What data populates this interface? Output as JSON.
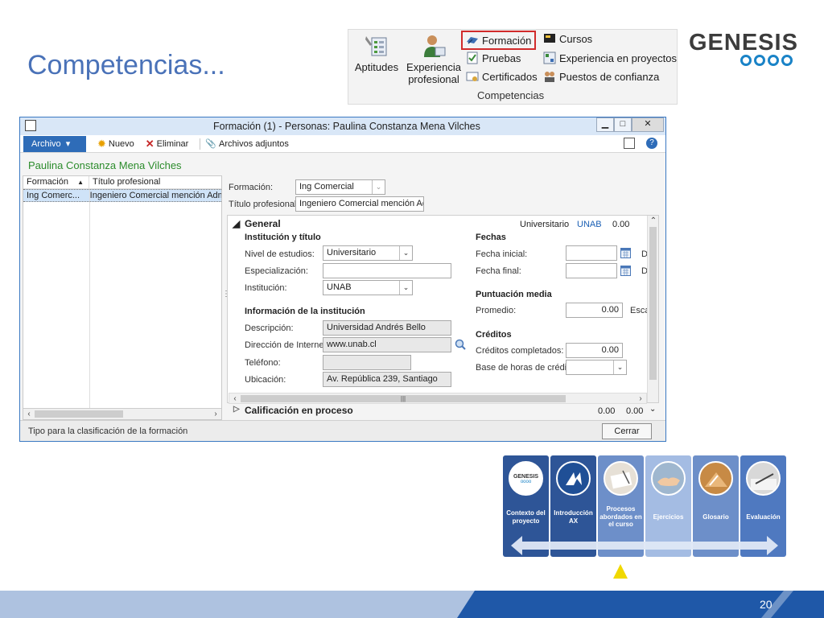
{
  "slide": {
    "title": "Competencias...",
    "page_number": "20"
  },
  "ribbon": {
    "aptitudes": "Aptitudes",
    "experiencia_line1": "Experiencia",
    "experiencia_line2": "profesional",
    "formacion": "Formación",
    "pruebas": "Pruebas",
    "certificados": "Certificados",
    "cursos": "Cursos",
    "experiencia_proyectos": "Experiencia en proyectos",
    "puestos_confianza": "Puestos de confianza",
    "group_label": "Competencias",
    "highlight_color": "#d12b2b"
  },
  "logo": {
    "text": "GENESIS",
    "ring_color": "#1a83c7"
  },
  "window": {
    "title": "Formación (1) - Personas: Paulina Constanza Mena  Vilches",
    "min_label": "▁",
    "max_label": "□",
    "close_label": "✕",
    "toolbar": {
      "archivo": "Archivo",
      "nuevo": "Nuevo",
      "eliminar": "Eliminar",
      "adjuntos": "Archivos adjuntos"
    },
    "person_name": "Paulina Constanza Mena  Vilches",
    "grid": {
      "col_formacion": "Formación",
      "col_titulo": "Título profesional",
      "rows": [
        {
          "formacion": "Ing Comerc...",
          "titulo": "Ingeniero Comercial mención Admi"
        }
      ]
    },
    "header_fields": {
      "formacion_label": "Formación:",
      "formacion_value": "Ing Comercial",
      "titulo_label": "Título profesional:",
      "titulo_value": "Ingeniero Comercial mención Adn"
    },
    "general": {
      "title": "General",
      "summary_nivel": "Universitario",
      "summary_inst": "UNAB",
      "summary_num": "0.00",
      "inst_titulo_head": "Institución y título",
      "nivel_label": "Nivel de estudios:",
      "nivel_value": "Universitario",
      "especializacion_label": "Especialización:",
      "especializacion_value": "",
      "institucion_label": "Institución:",
      "institucion_value": "UNAB",
      "info_inst_head": "Información de la institución",
      "descripcion_label": "Descripción:",
      "descripcion_value": "Universidad Andrés Bello",
      "direccion_label": "Dirección de Internet:",
      "direccion_value": "www.unab.cl",
      "telefono_label": "Teléfono:",
      "telefono_value": "",
      "ubicacion_label": "Ubicación:",
      "ubicacion_value": "Av. República 239, Santiago",
      "fechas_head": "Fechas",
      "fecha_inicial_label": "Fecha inicial:",
      "fecha_final_label": "Fecha final:",
      "d_suffix": "D",
      "puntuacion_head": "Puntuación media",
      "promedio_label": "Promedio:",
      "promedio_value": "0.00",
      "escala_suffix": "Esca",
      "creditos_head": "Créditos",
      "creditos_completados_label": "Créditos completados:",
      "creditos_completados_value": "0.00",
      "base_horas_label": "Base de horas de crédito:",
      "base_horas_value": ""
    },
    "calificacion": {
      "title": "Calificación en proceso",
      "val1": "0.00",
      "val2": "0.00"
    },
    "status_text": "Tipo para la clasificación de la formación",
    "close_button": "Cerrar"
  },
  "nav": {
    "items": [
      {
        "label": "Contexto del proyecto",
        "color": "#2e5597"
      },
      {
        "label": "Introducción AX",
        "color": "#2e5597"
      },
      {
        "label": "Procesos abordados en el curso",
        "color": "#6d8fc9"
      },
      {
        "label": "Ejercicios",
        "color": "#a4bce3"
      },
      {
        "label": "Glosario",
        "color": "#6d8fc9"
      },
      {
        "label": "Evaluación",
        "color": "#4f79c0"
      }
    ],
    "circle_texts": {
      "genesis": "GENESIS"
    }
  },
  "colors": {
    "title_blue": "#4a72b8",
    "footer_dark": "#1f58a8",
    "footer_light": "#aec2e0",
    "green_name": "#2c8c2c",
    "link_blue": "#1a5fb4"
  }
}
